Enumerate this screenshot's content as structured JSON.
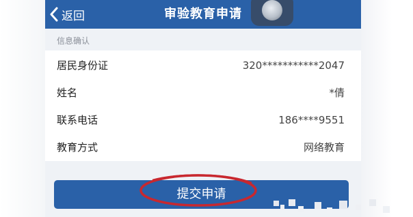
{
  "header": {
    "back_label": "返回",
    "title": "审验教育申请"
  },
  "section": {
    "title": "信息确认"
  },
  "info_rows": [
    {
      "label": "居民身份证",
      "value": "320***********2047"
    },
    {
      "label": "姓名",
      "value": "*倩"
    },
    {
      "label": "联系电话",
      "value": "186****9551"
    },
    {
      "label": "教育方式",
      "value": "网络教育"
    }
  ],
  "actions": {
    "submit_label": "提交申请"
  },
  "colors": {
    "primary": "#2a61a8",
    "annotation_ring": "#c8282f",
    "page_background": "#eff2f6"
  },
  "icons": {
    "back": "chevron-left-icon",
    "floating": "assistive-touch-icon"
  }
}
